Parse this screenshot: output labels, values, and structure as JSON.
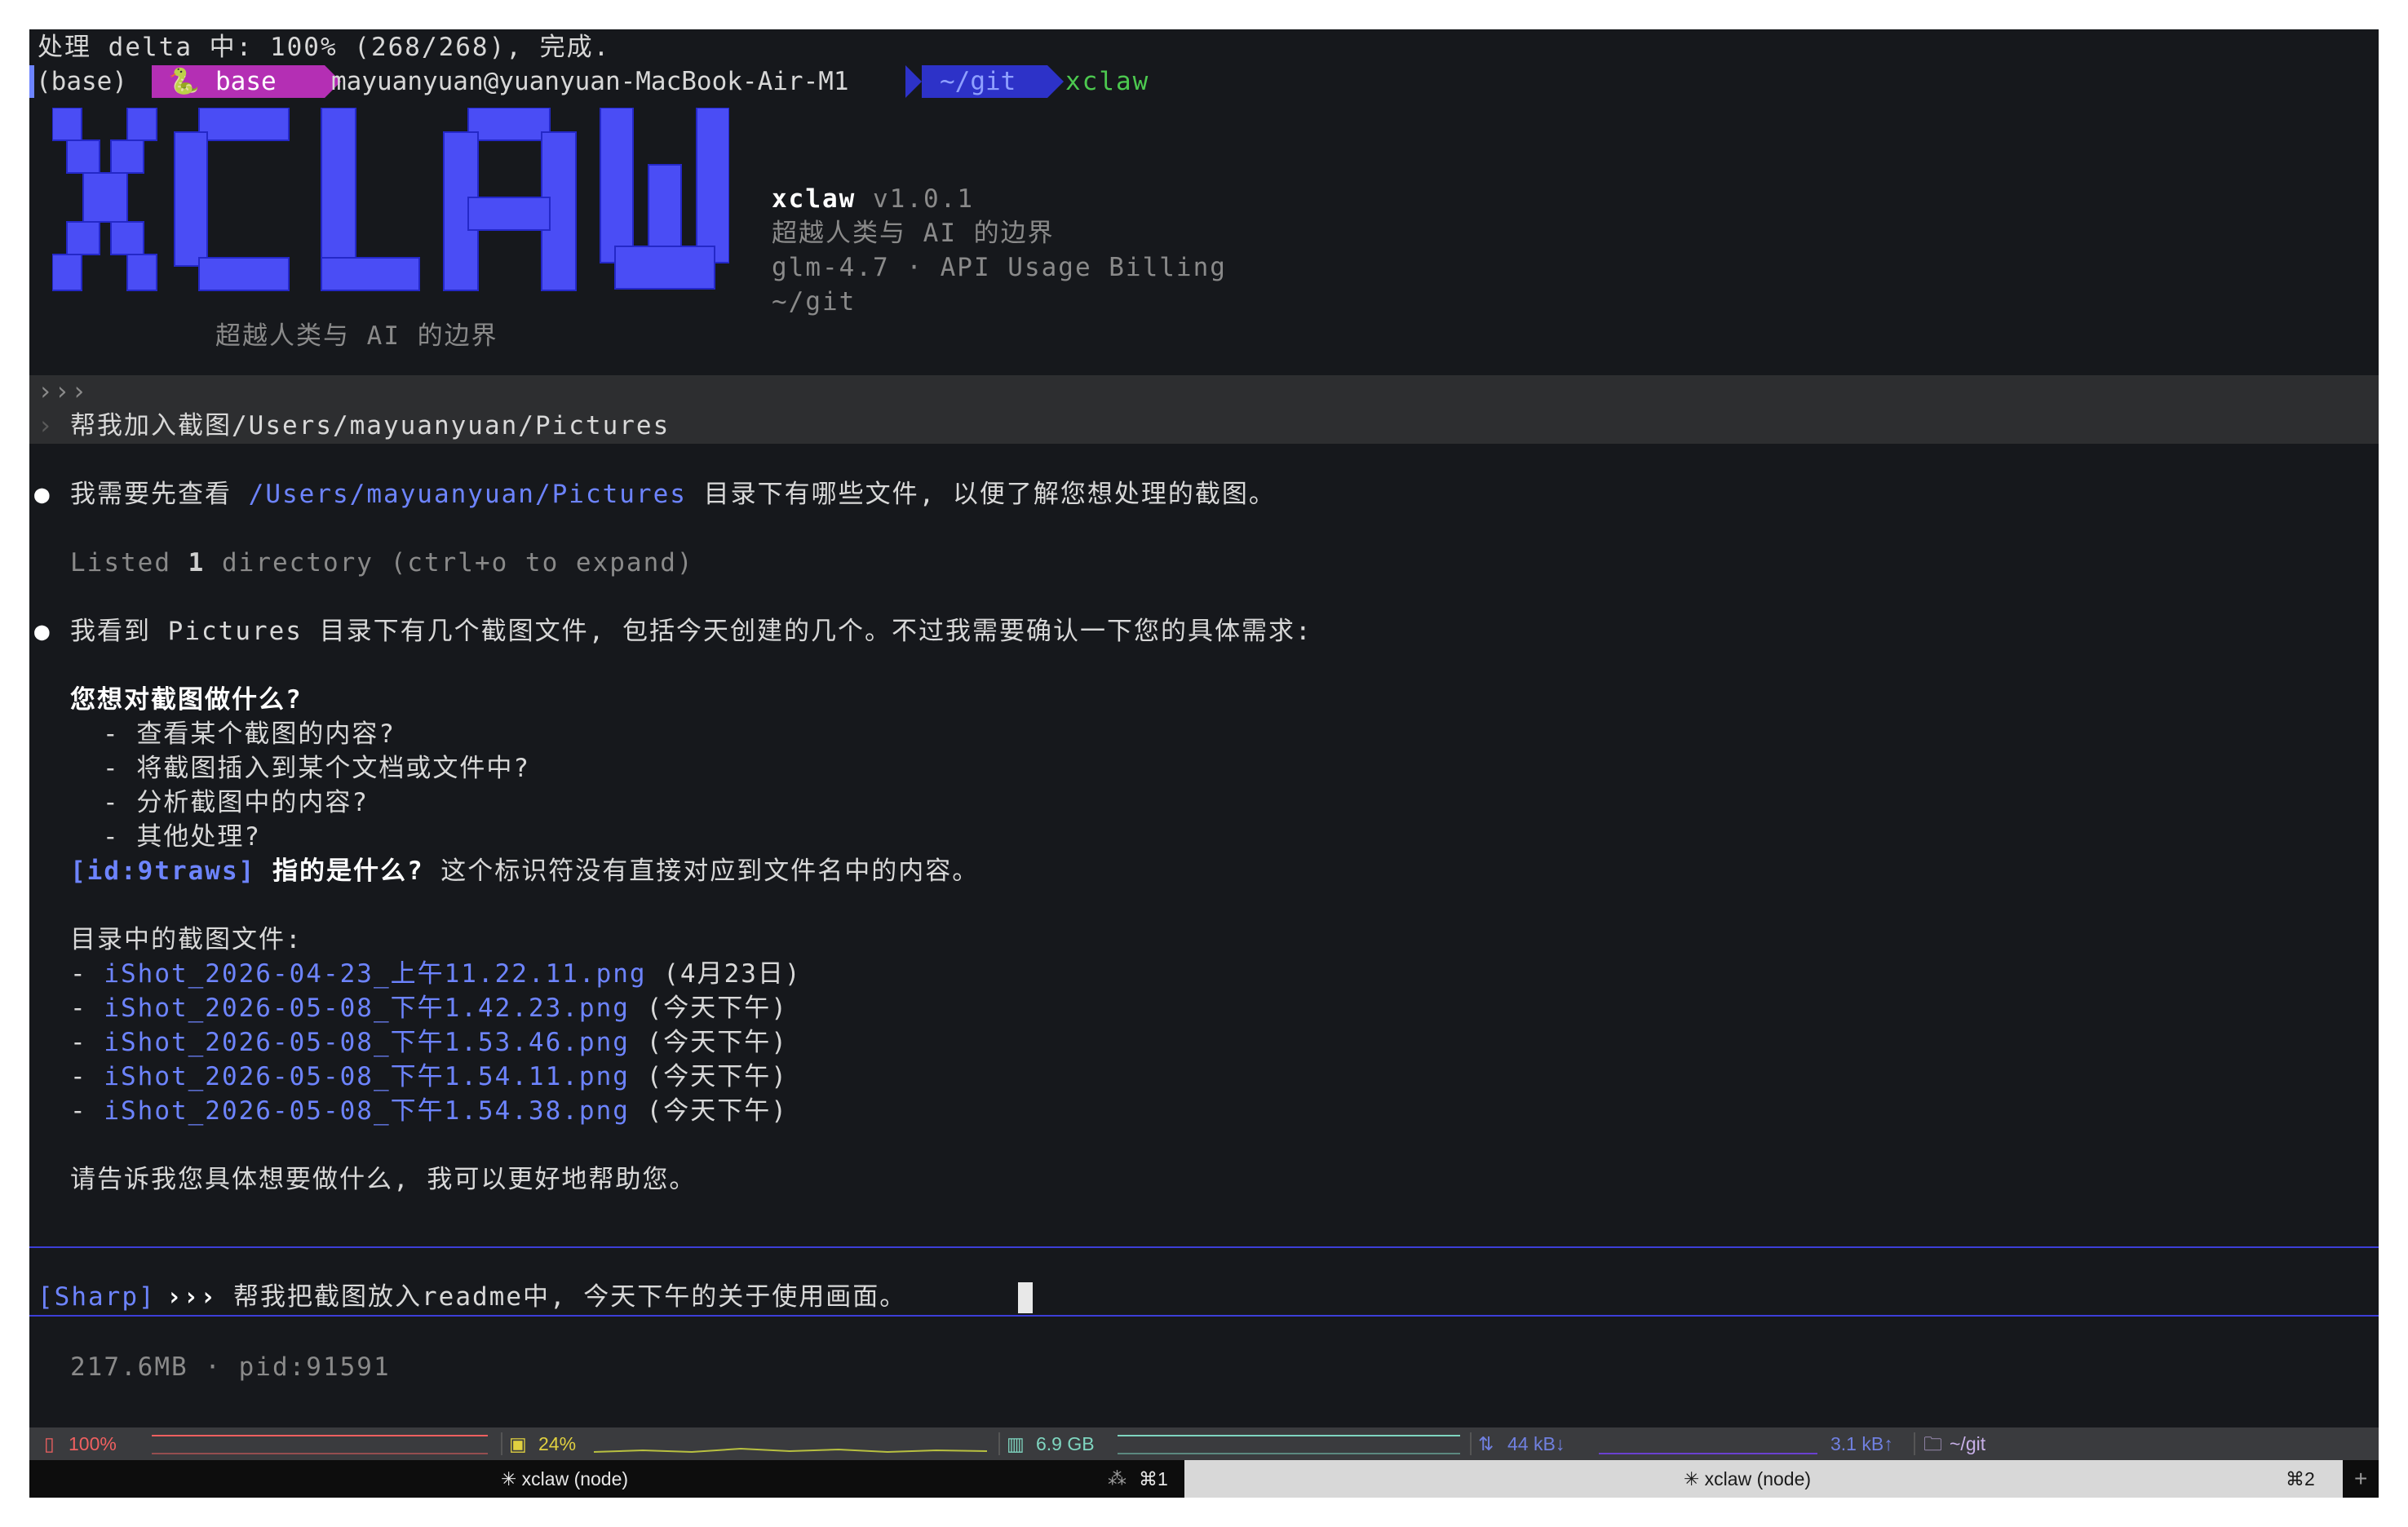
{
  "terminal": {
    "progress_line": "处理 delta 中: 100% (268/268), 完成.",
    "prompt": {
      "env": "(base)",
      "conda_icon": "snake-icon",
      "conda_env": "base",
      "user_host": "mayuanyuan@yuanyuan-MacBook-Air-M1",
      "path": "~/git",
      "command": "xclaw"
    },
    "banner": {
      "logo_text": "XCLAW",
      "logo_tagline": "超越人类与 AI 的边界",
      "app_name": "xclaw",
      "version": "v1.0.1",
      "tagline": "超越人类与 AI 的边界",
      "model_line": "glm-4.7 · API Usage Billing",
      "cwd": "~/git"
    },
    "user_input": {
      "prompt_marker": "›››",
      "prefix_marker": "›",
      "text": "帮我加入截图/Users/mayuanyuan/Pictures"
    },
    "response1": {
      "bullet": "●",
      "text_before": "我需要先查看 ",
      "path": "/Users/mayuanyuan/Pictures",
      "text_after": " 目录下有哪些文件, 以便了解您想处理的截图。"
    },
    "tool_result": {
      "before": "Listed ",
      "count": "1",
      "after": " directory (ctrl+o to expand)"
    },
    "response2": {
      "bullet": "●",
      "intro": "我看到 Pictures 目录下有几个截图文件, 包括今天创建的几个。不过我需要确认一下您的具体需求:",
      "question1": "您想对截图做什么?",
      "options": [
        "- 查看某个截图的内容?",
        "- 将截图插入到某个文档或文件中?",
        "- 分析截图中的内容?",
        "- 其他处理?"
      ],
      "id_tag": "[id:9traws]",
      "id_question": " 指的是什么?",
      "id_note": " 这个标识符没有直接对应到文件名中的内容。",
      "files_heading": "目录中的截图文件:",
      "files": [
        {
          "name": "iShot_2026-04-23_上午11.22.11.png",
          "note": " (4月23日)"
        },
        {
          "name": "iShot_2026-05-08_下午1.42.23.png",
          "note": " (今天下午)"
        },
        {
          "name": "iShot_2026-05-08_下午1.53.46.png",
          "note": " (今天下午)"
        },
        {
          "name": "iShot_2026-05-08_下午1.54.11.png",
          "note": " (今天下午)"
        },
        {
          "name": "iShot_2026-05-08_下午1.54.38.png",
          "note": " (今天下午)"
        }
      ],
      "closing": "请告诉我您具体想要做什么, 我可以更好地帮助您。"
    },
    "input_box": {
      "mode": "[Sharp]",
      "marker": "›››",
      "text": "帮我把截图放入readme中, 今天下午的关于使用画面。"
    },
    "footer": "217.6MB · pid:91591"
  },
  "status_bar": {
    "battery": "100%",
    "cpu": "24%",
    "memory": "6.9 GB",
    "net_down": "44 kB↓",
    "net_up": "3.1 kB↑",
    "dir": "~/git"
  },
  "tabs": [
    {
      "label": "✳ xclaw (node)",
      "shortcut": "⌘1",
      "active": false
    },
    {
      "label": "✳ xclaw (node)",
      "shortcut": "⌘2",
      "active": true
    }
  ],
  "colors": {
    "background": "#16181c",
    "logo": "#4a4df5",
    "link": "#6d84ff",
    "prompt_env_bg": "#b42fb4",
    "prompt_path_bg": "#2d32c8",
    "command": "#4cc94f",
    "divider": "#3d3fd8"
  }
}
